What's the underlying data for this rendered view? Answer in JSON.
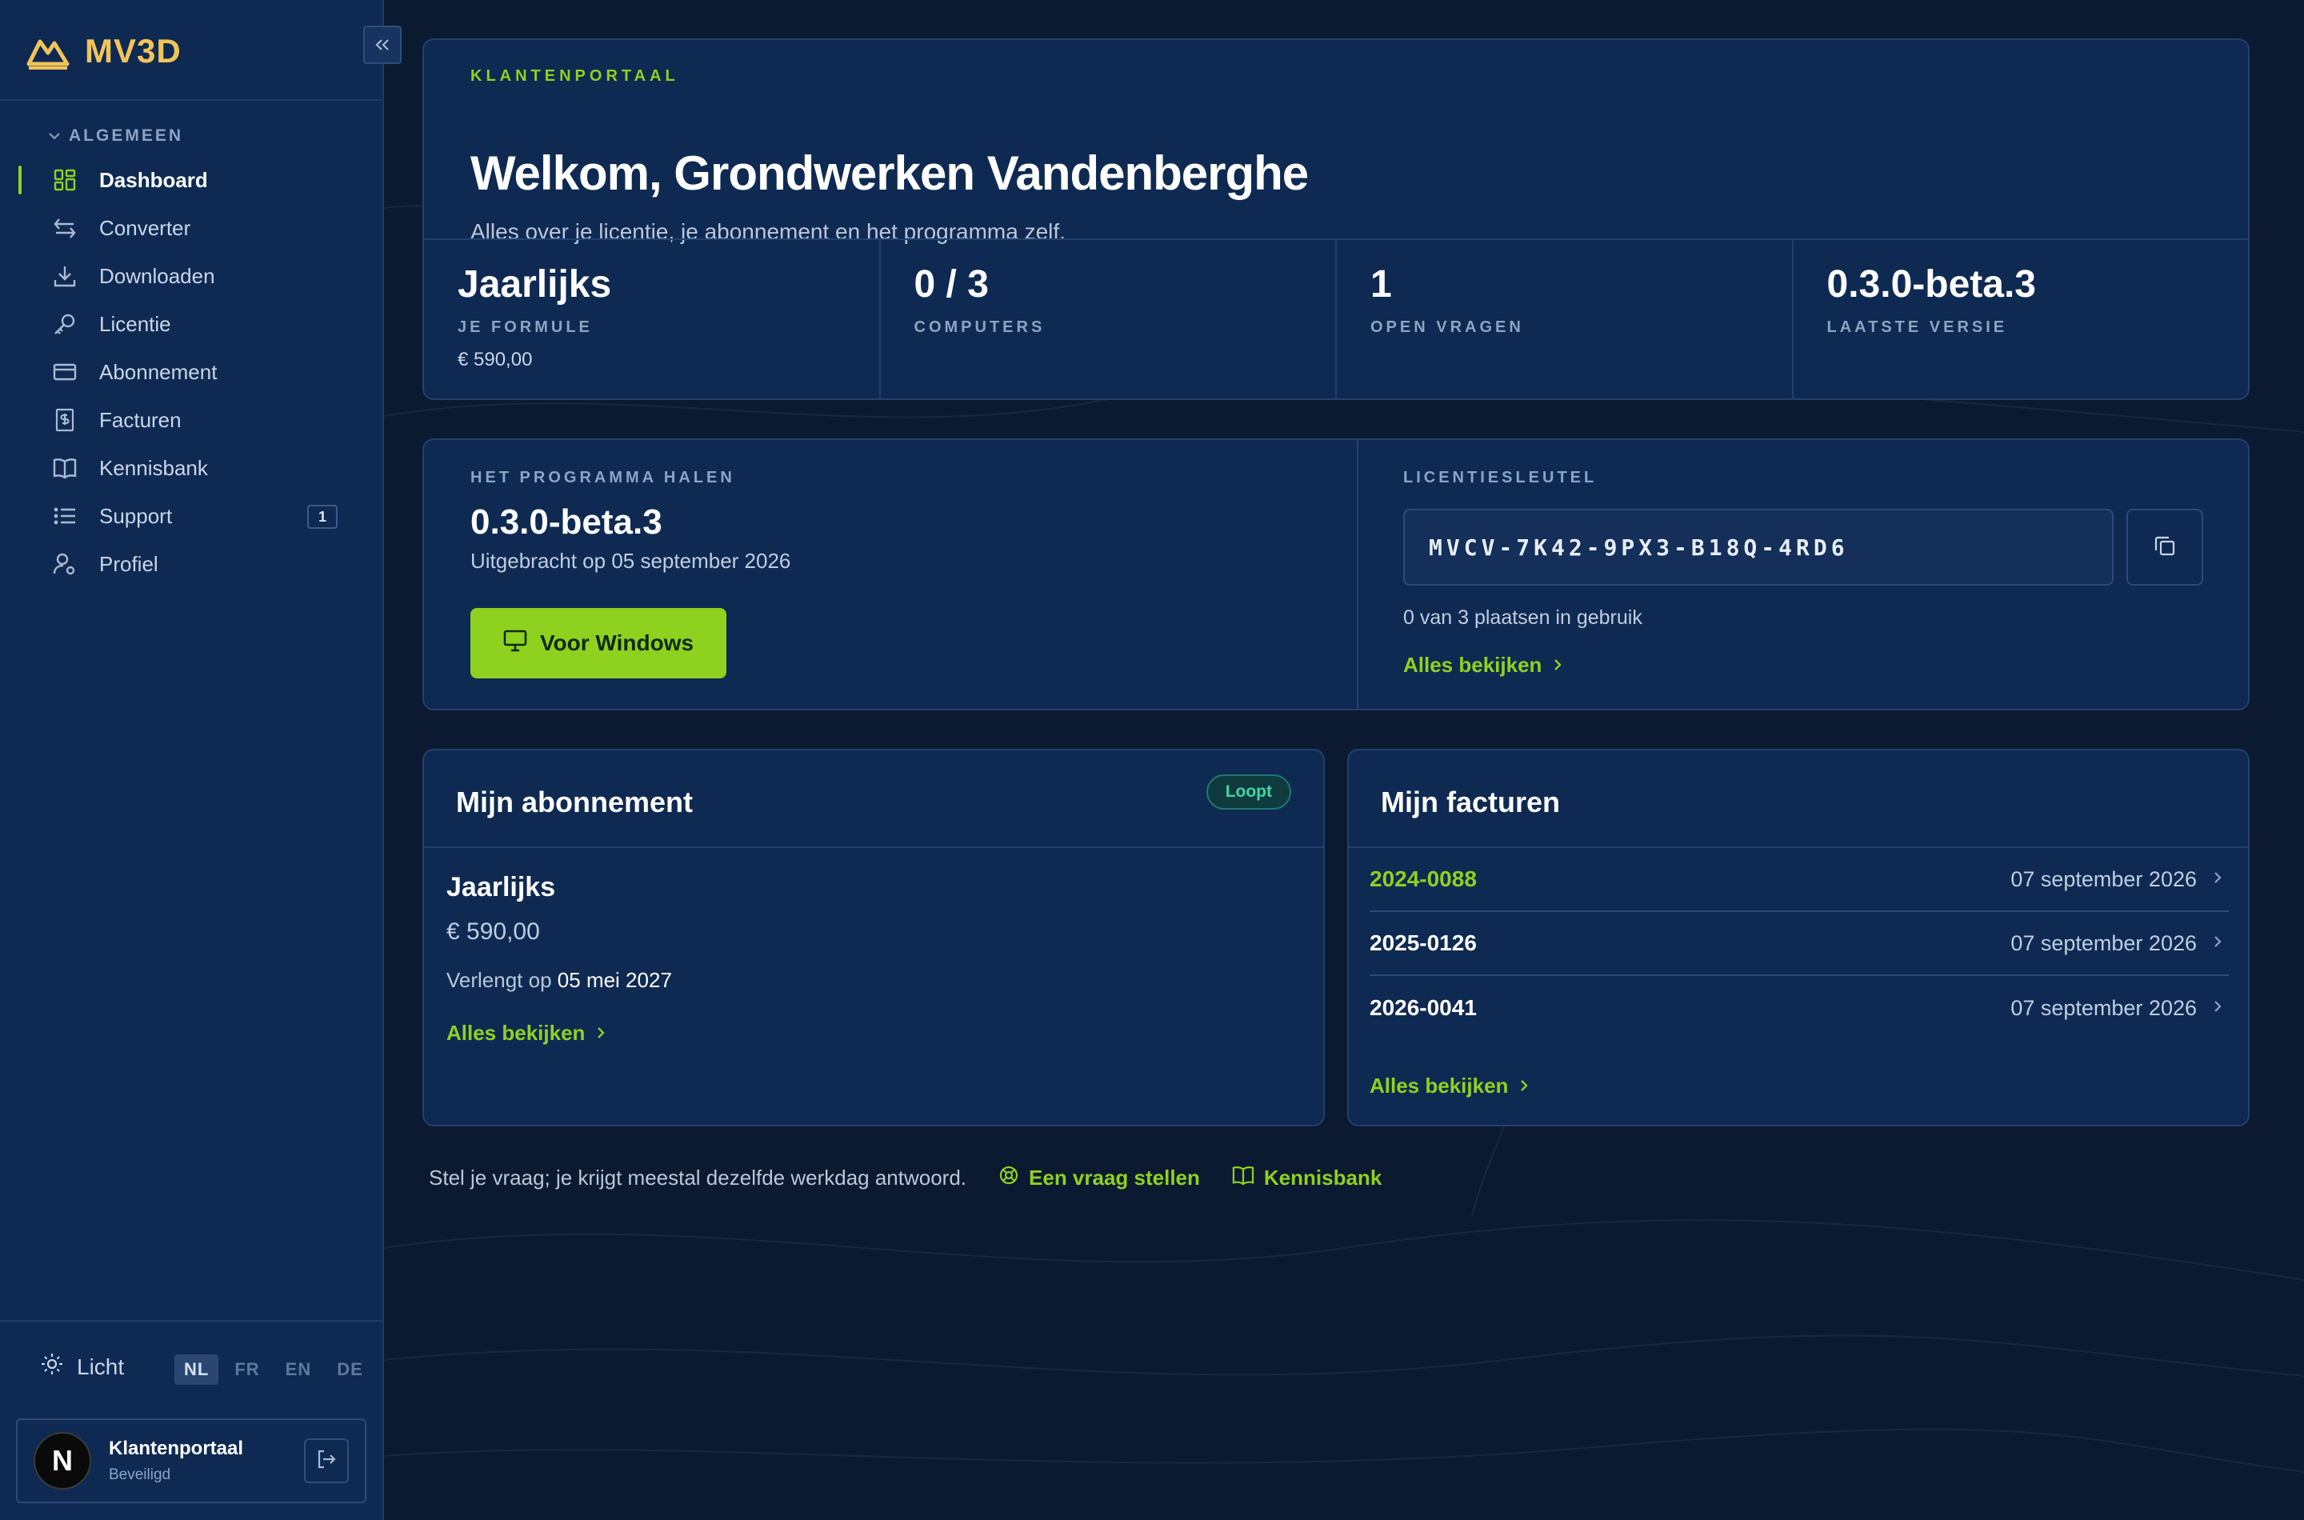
{
  "brand": {
    "name": "MV3D"
  },
  "sidebar": {
    "section_label": "ALGEMEEN",
    "items": [
      {
        "label": "Dashboard",
        "icon": "grid-icon",
        "active": true
      },
      {
        "label": "Converter",
        "icon": "swap-arrows-icon"
      },
      {
        "label": "Downloaden",
        "icon": "download-icon"
      },
      {
        "label": "Licentie",
        "icon": "key-icon"
      },
      {
        "label": "Abonnement",
        "icon": "credit-card-icon"
      },
      {
        "label": "Facturen",
        "icon": "receipt-dollar-icon"
      },
      {
        "label": "Kennisbank",
        "icon": "book-open-icon"
      },
      {
        "label": "Support",
        "icon": "list-icon",
        "badge": "1"
      },
      {
        "label": "Profiel",
        "icon": "user-gear-icon"
      }
    ],
    "theme_label": "Licht",
    "languages": [
      "NL",
      "FR",
      "EN",
      "DE"
    ],
    "active_language": "NL",
    "user": {
      "initial": "N",
      "name": "Klantenportaal",
      "sub": "Beveiligd"
    }
  },
  "hero": {
    "eyebrow": "KLANTENPORTAAL",
    "title": "Welkom, Grondwerken Vandenberghe",
    "subtitle": "Alles over je licentie, je abonnement en het programma zelf.",
    "stats": [
      {
        "value": "Jaarlijks",
        "label": "JE FORMULE",
        "sub": "€ 590,00"
      },
      {
        "value": "0 / 3",
        "label": "COMPUTERS",
        "sub": ""
      },
      {
        "value": "1",
        "label": "OPEN VRAGEN",
        "sub": ""
      },
      {
        "value": "0.3.0-beta.3",
        "label": "LAATSTE VERSIE",
        "sub": ""
      }
    ]
  },
  "download": {
    "eyebrow": "HET PROGRAMMA HALEN",
    "version": "0.3.0-beta.3",
    "released": "Uitgebracht op 05 september 2026",
    "button_label": "Voor Windows"
  },
  "license": {
    "eyebrow": "LICENTIESLEUTEL",
    "key": "MVCV-7K42-9PX3-B18Q-4RD6",
    "seats": "0 van 3 plaatsen in gebruik",
    "link": "Alles bekijken"
  },
  "subscription": {
    "title": "Mijn abonnement",
    "status": "Loopt",
    "plan": "Jaarlijks",
    "price": "€ 590,00",
    "renew_prefix": "Verlengt op",
    "renew_date": "05 mei 2027",
    "link": "Alles bekijken"
  },
  "invoices": {
    "title": "Mijn facturen",
    "rows": [
      {
        "number": "2024-0088",
        "date": "07 september 2026"
      },
      {
        "number": "2025-0126",
        "date": "07 september 2026"
      },
      {
        "number": "2026-0041",
        "date": "07 september 2026"
      }
    ],
    "link": "Alles bekijken"
  },
  "footer": {
    "text": "Stel je vraag; je krijgt meestal dezelfde werkdag antwoord.",
    "ask_link": "Een vraag stellen",
    "kb_link": "Kennisbank"
  },
  "colors": {
    "accent": "#8fd11f",
    "brand": "#f1c45a",
    "background": "#0b1a30",
    "panel": "#0f2a52",
    "status": "#44d3a6"
  }
}
